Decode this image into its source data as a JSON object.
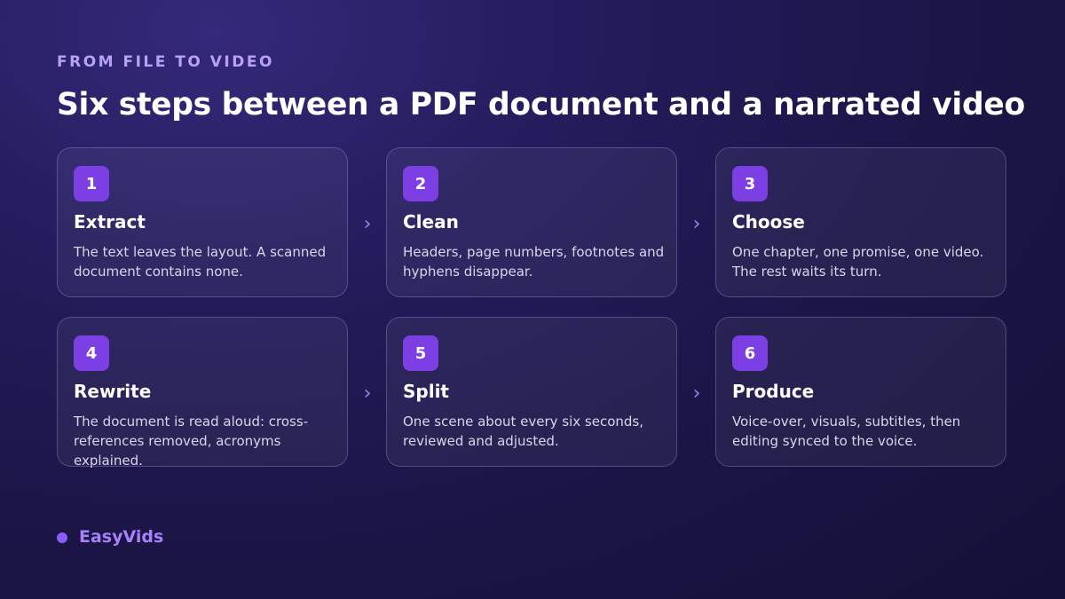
{
  "eyebrow": "FROM FILE TO VIDEO",
  "title": "Six steps between a PDF document and a narrated video",
  "steps": [
    {
      "number": "1",
      "title": "Extract",
      "description": "The text leaves the layout. A scanned document contains none."
    },
    {
      "number": "2",
      "title": "Clean",
      "description": "Headers, page numbers, footnotes and hyphens disappear."
    },
    {
      "number": "3",
      "title": "Choose",
      "description": "One chapter, one promise, one video. The rest waits its turn."
    },
    {
      "number": "4",
      "title": "Rewrite",
      "description": "The document is read aloud: cross-references removed, acronyms explained."
    },
    {
      "number": "5",
      "title": "Split",
      "description": "One scene about every six seconds, reviewed and adjusted."
    },
    {
      "number": "6",
      "title": "Produce",
      "description": "Voice-over, visuals, subtitles, then editing synced to the voice."
    }
  ],
  "arrow_glyph": "›",
  "brand": {
    "name": "EasyVids"
  },
  "colors": {
    "accent": "#7b3fe4",
    "eyebrow": "#b9a2f6",
    "brand": "#a880f7",
    "background": "#1a1545"
  }
}
